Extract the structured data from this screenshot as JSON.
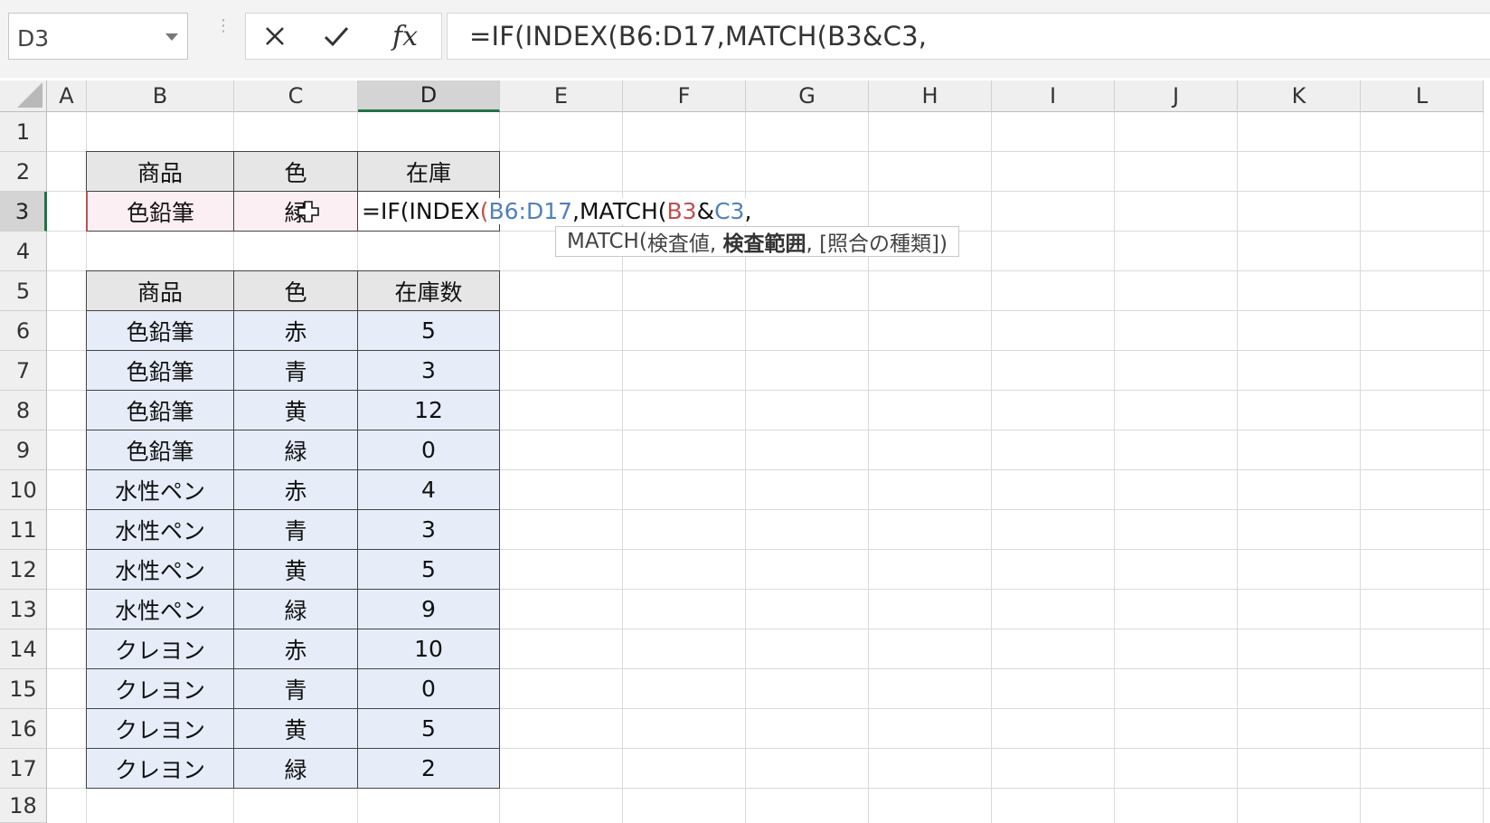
{
  "name_box": {
    "value": "D3"
  },
  "formula_bar": {
    "cancel_icon": "close-icon",
    "enter_icon": "check-icon",
    "fx_label": "fx",
    "text": "=IF(INDEX(B6:D17,MATCH(B3&C3,"
  },
  "columns": [
    "A",
    "B",
    "C",
    "D",
    "E",
    "F",
    "G",
    "H",
    "I",
    "J",
    "K",
    "L"
  ],
  "rows": [
    "1",
    "2",
    "3",
    "4",
    "5",
    "6",
    "7",
    "8",
    "9",
    "10",
    "11",
    "12",
    "13",
    "14",
    "15",
    "16",
    "17",
    "18"
  ],
  "selected_cell": {
    "column": "D",
    "row": "3"
  },
  "lookup_table": {
    "headers": [
      "商品",
      "色",
      "在庫"
    ],
    "input": {
      "product": "色鉛筆",
      "color": "緑"
    }
  },
  "inventory_table": {
    "headers": [
      "商品",
      "色",
      "在庫数"
    ],
    "rows": [
      [
        "色鉛筆",
        "赤",
        "5"
      ],
      [
        "色鉛筆",
        "青",
        "3"
      ],
      [
        "色鉛筆",
        "黄",
        "12"
      ],
      [
        "色鉛筆",
        "緑",
        "0"
      ],
      [
        "水性ペン",
        "赤",
        "4"
      ],
      [
        "水性ペン",
        "青",
        "3"
      ],
      [
        "水性ペン",
        "黄",
        "5"
      ],
      [
        "水性ペン",
        "緑",
        "9"
      ],
      [
        "クレヨン",
        "赤",
        "10"
      ],
      [
        "クレヨン",
        "青",
        "0"
      ],
      [
        "クレヨン",
        "黄",
        "5"
      ],
      [
        "クレヨン",
        "緑",
        "2"
      ]
    ]
  },
  "in_cell_formula": {
    "p1": "=IF(INDEX",
    "p2": "(",
    "p3": "B6:D17",
    "p4": ",MATCH(",
    "p5": "B3",
    "p6": "&",
    "p7": "C3",
    "p8": ","
  },
  "tooltip": {
    "fn": "MATCH(",
    "arg1": "検査値, ",
    "arg2": "検査範囲",
    "arg3": ", [照合の種類])"
  },
  "colors": {
    "ref_red": "#c0504d",
    "ref_blue": "#4f81bd",
    "accent_green": "#217346"
  }
}
